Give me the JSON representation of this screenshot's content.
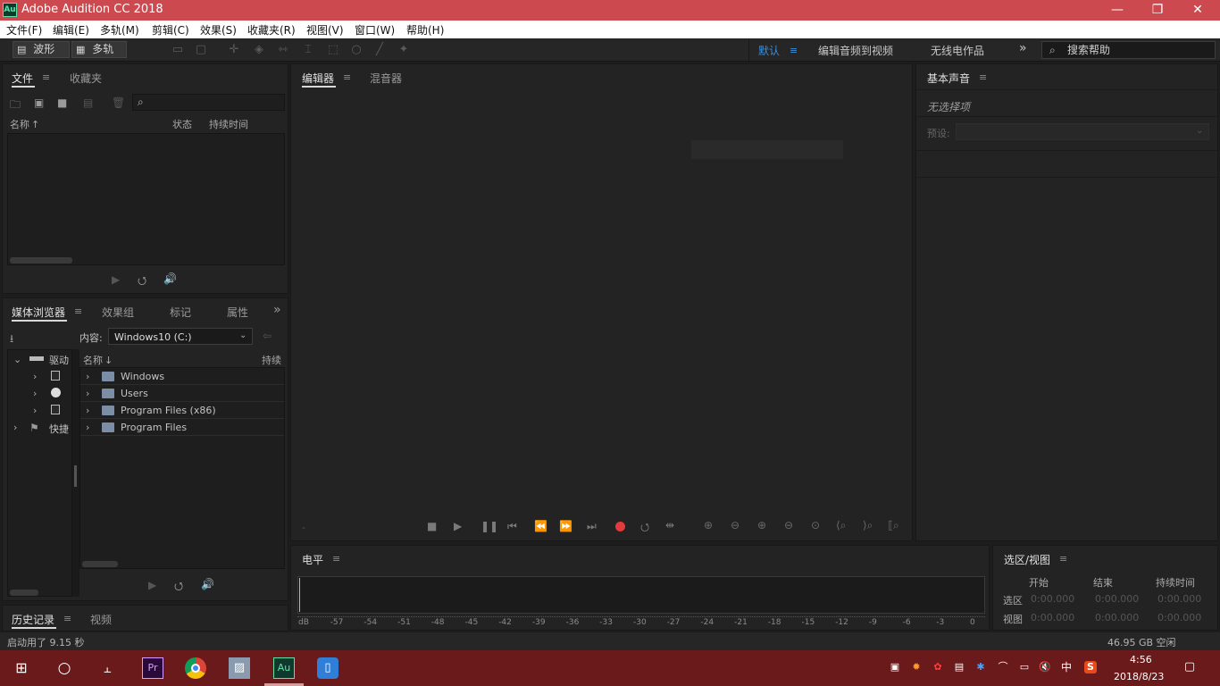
{
  "window": {
    "app_icon": "Au",
    "title": "Adobe Audition CC 2018"
  },
  "menu": [
    "文件(F)",
    "编辑(E)",
    "多轨(M)",
    "剪辑(C)",
    "效果(S)",
    "收藏夹(R)",
    "视图(V)",
    "窗口(W)",
    "帮助(H)"
  ],
  "toolbar": {
    "waveform_label": "波形",
    "multitrack_label": "多轨"
  },
  "workspaces": {
    "default": "默认",
    "edit_to_video": "编辑音频到视频",
    "radio": "无线电作品",
    "overflow": "»"
  },
  "help_search": {
    "placeholder": "搜索帮助"
  },
  "files_panel": {
    "tabs": [
      "文件",
      "收藏夹"
    ],
    "columns": {
      "name": "名称",
      "status": "状态",
      "duration": "持续时间"
    }
  },
  "media_panel": {
    "tabs": [
      "媒体浏览器",
      "效果组",
      "标记",
      "属性"
    ],
    "overflow": "»",
    "content_label": "内容:",
    "content_value": "Windows10 (C:)",
    "tree": [
      {
        "label": "驱动"
      },
      {
        "label": "快捷"
      }
    ],
    "columns": {
      "name": "名称",
      "duration": "持续"
    },
    "rows": [
      "Windows",
      "Users",
      "Program Files (x86)",
      "Program Files"
    ]
  },
  "history_panel": {
    "tabs": [
      "历史记录",
      "视频"
    ]
  },
  "editor_panel": {
    "tabs": [
      "编辑器",
      "混音器"
    ]
  },
  "essential_sound": {
    "title": "基本声音",
    "no_selection": "无选择项",
    "preset_label": "预设:"
  },
  "level_panel": {
    "title": "电平",
    "ticks": [
      "dB",
      "-57",
      "-54",
      "-51",
      "-48",
      "-45",
      "-42",
      "-39",
      "-36",
      "-33",
      "-30",
      "-27",
      "-24",
      "-21",
      "-18",
      "-15",
      "-12",
      "-9",
      "-6",
      "-3",
      "0"
    ]
  },
  "selection_panel": {
    "title": "选区/视图",
    "headers": {
      "start": "开始",
      "end": "结束",
      "duration": "持续时间"
    },
    "rows": [
      {
        "label": "选区",
        "start": "0:00.000",
        "end": "0:00.000",
        "duration": "0:00.000"
      },
      {
        "label": "视图",
        "start": "0:00.000",
        "end": "0:00.000",
        "duration": "0:00.000"
      }
    ]
  },
  "status": {
    "message": "启动用了 9.15 秒",
    "disk_free": "46.95 GB 空闲"
  },
  "taskbar": {
    "apps": [
      "start-icon",
      "cortana-icon",
      "task-view-icon",
      "premiere-icon",
      "chrome-icon",
      "photos-icon",
      "audition-icon",
      "phone-icon"
    ],
    "premiere_label": "Pr",
    "audition_label": "Au",
    "ime": "中",
    "time": "4:56",
    "date": "2018/8/23"
  },
  "colors": {
    "titlebar": "#cc4a4f",
    "accent": "#3a8fdc",
    "record": "#e23b3b",
    "taskbar": "#6a1a1a"
  }
}
